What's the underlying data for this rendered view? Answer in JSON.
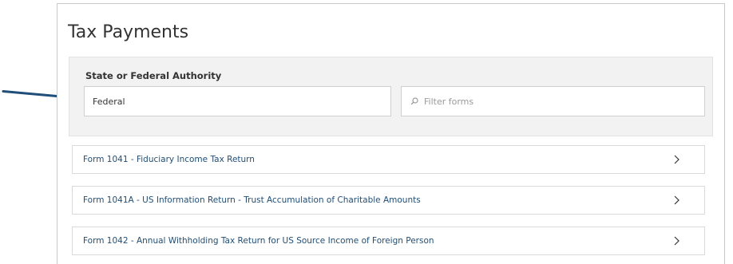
{
  "page": {
    "title": "Tax Payments"
  },
  "filter": {
    "authority_label": "State or Federal Authority",
    "authority_value": "Federal",
    "search_placeholder": "Filter forms",
    "search_value": ""
  },
  "forms": [
    {
      "label": "Form 1041 - Fiduciary Income Tax Return"
    },
    {
      "label": "Form 1041A - US Information Return - Trust Accumulation of Charitable Amounts"
    },
    {
      "label": "Form 1042 - Annual Withholding Tax Return for US Source Income of Foreign Person"
    }
  ],
  "icons": {
    "annotation_arrow": "arrow-right-icon",
    "search": "search-icon",
    "row_chevron": "chevron-right-icon"
  },
  "colors": {
    "arrow": "#1f4e79",
    "link_text": "#1f4e79",
    "filter_background": "#f2f2f2"
  }
}
